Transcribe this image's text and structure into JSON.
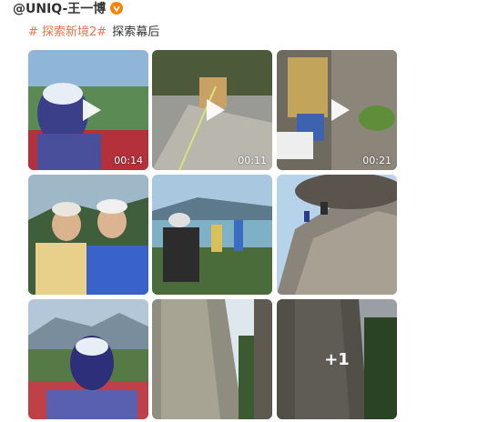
{
  "post": {
    "author": "@UNIQ-王一博",
    "verified_badge_icon": "verified-v-icon",
    "topic": "# 探索新境2#",
    "text": "探索幕后"
  },
  "media": [
    {
      "type": "video",
      "duration": "00:14",
      "desc": "selfie-face-covered"
    },
    {
      "type": "video",
      "duration": "00:11",
      "desc": "rock-climbing-rope"
    },
    {
      "type": "video",
      "duration": "00:21",
      "desc": "climber-harness"
    },
    {
      "type": "image",
      "desc": "two-climbers-helmets"
    },
    {
      "type": "image",
      "desc": "climbers-overlook-lake"
    },
    {
      "type": "image",
      "desc": "climbers-on-rock-face"
    },
    {
      "type": "image",
      "desc": "selfie-face-covered-mountains"
    },
    {
      "type": "image",
      "desc": "granite-cliff"
    },
    {
      "type": "image",
      "more": "+1",
      "desc": "granite-cliff-forest"
    }
  ],
  "colors": {
    "topic": "#eb7350",
    "badge": "#ff8200"
  }
}
